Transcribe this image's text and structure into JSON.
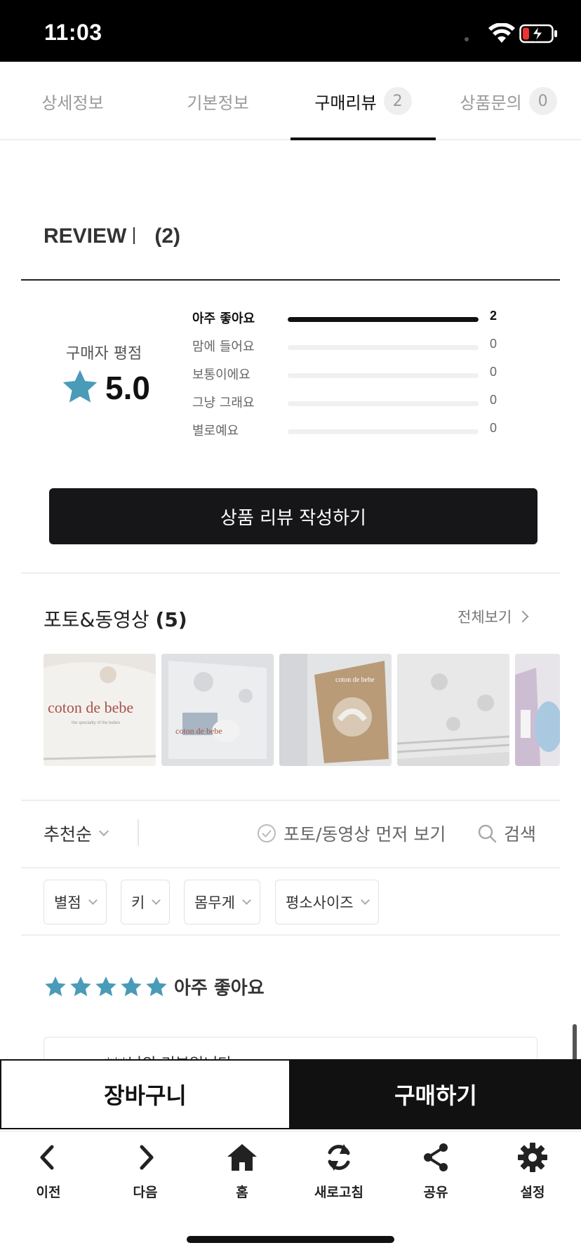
{
  "status_bar": {
    "time": "11:03"
  },
  "tabs": [
    {
      "label": "상세정보",
      "count": null
    },
    {
      "label": "기본정보",
      "count": null
    },
    {
      "label": "구매리뷰",
      "count": "2"
    },
    {
      "label": "상품문의",
      "count": "0"
    }
  ],
  "review": {
    "title": "REVIEW",
    "count": "(2)",
    "rating_label": "구매자 평점",
    "rating_value": "5.0",
    "distribution": [
      {
        "label": "아주 좋아요",
        "count": "2",
        "fraction": 1.0
      },
      {
        "label": "맘에 들어요",
        "count": "0",
        "fraction": 0
      },
      {
        "label": "보통이에요",
        "count": "0",
        "fraction": 0
      },
      {
        "label": "그냥 그래요",
        "count": "0",
        "fraction": 0
      },
      {
        "label": "별로예요",
        "count": "0",
        "fraction": 0
      }
    ],
    "write_button": "상품 리뷰 작성하기"
  },
  "photos": {
    "title": "포토&동영상",
    "count": "(5)",
    "view_all": "전체보기",
    "thumbs": [
      {
        "text": "coton de bebe",
        "sub": "the speciality of the bebes"
      },
      {
        "text": "coton de bebe"
      },
      {
        "text": "coton de bebe"
      },
      {
        "text": ""
      },
      {
        "text": ""
      }
    ]
  },
  "filters": {
    "sort": "추천순",
    "photo_first": "포토/동영상 먼저 보기",
    "search": "검색",
    "chips": [
      "별점",
      "키",
      "몸무게",
      "평소사이즈"
    ]
  },
  "review_item": {
    "stars": 5,
    "rating_text": "아주 좋아요",
    "author": "compr***님의 리뷰입니다."
  },
  "purchase": {
    "cart": "장바구니",
    "buy": "구매하기"
  },
  "bottom_nav": [
    {
      "label": "이전",
      "icon": "chevron-left-icon"
    },
    {
      "label": "다음",
      "icon": "chevron-right-icon"
    },
    {
      "label": "홈",
      "icon": "home-icon"
    },
    {
      "label": "새로고침",
      "icon": "refresh-icon"
    },
    {
      "label": "공유",
      "icon": "share-icon"
    },
    {
      "label": "설정",
      "icon": "gear-icon"
    }
  ],
  "colors": {
    "star": "#4a9bb8",
    "accent": "#111111"
  }
}
